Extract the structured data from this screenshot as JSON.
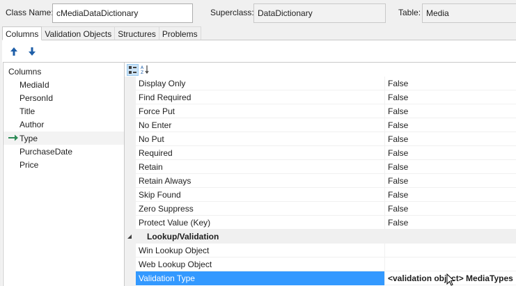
{
  "header": {
    "class_name_label": "Class Name:",
    "class_name_value": "cMediaDataDictionary",
    "superclass_label": "Superclass:",
    "superclass_value": "DataDictionary",
    "table_label": "Table:",
    "table_value": "Media"
  },
  "tabs": [
    {
      "label": "Columns",
      "active": true
    },
    {
      "label": "Validation Objects",
      "active": false
    },
    {
      "label": "Structures",
      "active": false
    },
    {
      "label": "Problems",
      "active": false
    }
  ],
  "toolbar": {
    "move_up_icon": "arrow-up-icon",
    "move_down_icon": "arrow-down-icon"
  },
  "tree": {
    "root_label": "Columns",
    "items": [
      "MediaId",
      "PersonId",
      "Title",
      "Author",
      "Type",
      "PurchaseDate",
      "Price"
    ],
    "current_index": 4
  },
  "grid": {
    "toolbar": {
      "categorized_icon": "categorized-icon",
      "sort_icon": "sort-az-icon"
    },
    "rows": [
      {
        "name": "Display Only",
        "value": "False"
      },
      {
        "name": "Find Required",
        "value": "False"
      },
      {
        "name": "Force Put",
        "value": "False"
      },
      {
        "name": "No Enter",
        "value": "False"
      },
      {
        "name": "No Put",
        "value": "False"
      },
      {
        "name": "Required",
        "value": "False"
      },
      {
        "name": "Retain",
        "value": "False"
      },
      {
        "name": "Retain Always",
        "value": "False"
      },
      {
        "name": "Skip Found",
        "value": "False"
      },
      {
        "name": "Zero Suppress",
        "value": "False"
      },
      {
        "name": "Protect Value (Key)",
        "value": "False"
      }
    ],
    "category": {
      "name": "Lookup/Validation"
    },
    "lookup_rows": [
      {
        "name": "Win Lookup Object",
        "value": ""
      },
      {
        "name": "Web Lookup Object",
        "value": ""
      },
      {
        "name": "Validation Type",
        "value": "<validation object> MediaTypes"
      }
    ]
  },
  "colors": {
    "accent": "#3399ff",
    "arrow_blue": "#1f5fa8",
    "current_arrow": "#2e8b57"
  }
}
